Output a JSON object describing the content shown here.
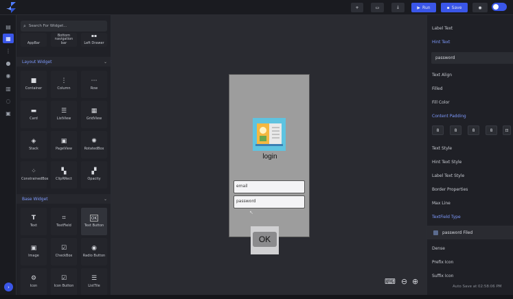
{
  "toolbar": {
    "add": "+",
    "run_label": "Run",
    "save_label": "Save"
  },
  "left_panel": {
    "search_placeholder": "Search For Widget...",
    "top_widgets": [
      "AppBar",
      "Bottom navigation bar",
      "Left Drawer"
    ],
    "layout_section": "Layout Widget",
    "layout_widgets": [
      "Container",
      "Column",
      "Row",
      "Card",
      "ListView",
      "GridView",
      "Stack",
      "PageView",
      "RotatedBox",
      "ConstrainedBox",
      "ClipRRect",
      "Opacity"
    ],
    "base_section": "Base Widget",
    "base_widgets": [
      "Text",
      "TextField",
      "Text Button",
      "Image",
      "CheckBox",
      "Radio Button",
      "Icon",
      "Icon Button",
      "ListTile"
    ]
  },
  "canvas": {
    "title": "login",
    "email_field": "email",
    "password_field": "password",
    "ok_button": "OK"
  },
  "props": {
    "label_text": "Label Text",
    "hint_text": "Hint Text",
    "hint_value": "password",
    "text_align": "Text Align",
    "filled": "Filled",
    "fill_color": "Fill Color",
    "content_padding": "Content Padding",
    "padding_values": [
      "8",
      "8",
      "8",
      "8"
    ],
    "text_style": "Text Style",
    "hint_text_style": "Hint Text Style",
    "label_text_style": "Label Text Style",
    "border_properties": "Border Properties",
    "max_line": "Max Line",
    "textfield_type": "TextField Type",
    "password_filed": "password Filed",
    "dense": "Dense",
    "prefix_icon": "Prefix Icon",
    "suffix_icon": "Suffix Icon"
  },
  "status": {
    "autosave": "Auto Save at 02:58:06 PM"
  },
  "colors": {
    "accent": "#3a56e8",
    "section_text": "#7f9bff",
    "background": "#1e1f24"
  }
}
